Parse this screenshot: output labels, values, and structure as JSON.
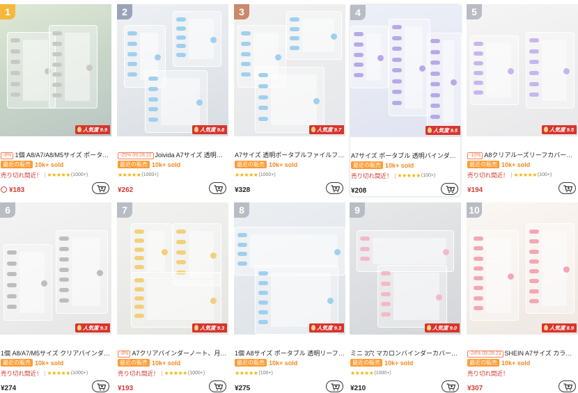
{
  "products": [
    {
      "rank": "1",
      "rank_style": "gold",
      "bg": "c1",
      "popularity": "人気度 9.9",
      "discount": "-8%",
      "title": "1個 A8/A7/A8/M5サイズ ポータ…",
      "sales_tag": "最近の販売",
      "sold": "10k+ sold",
      "stock": "売り切れ間近！",
      "stars": "★★★★★",
      "reviews": "(1000+)",
      "price": "¥183",
      "price_style": "red",
      "clock": true,
      "highlight": false,
      "ring": "#c8c8c8"
    },
    {
      "rank": "2",
      "rank_style": "silver",
      "bg": "c2",
      "popularity": "人気度 9.8",
      "discount": "-20% 09:28:22",
      "title": "Joivida A7サイズ 透明…",
      "sales_tag": "最近の販売",
      "sold": "10k+ sold",
      "stock": "",
      "stars": "★★★★★",
      "reviews": "(1000+)",
      "price": "¥262",
      "price_style": "red",
      "clock": false,
      "highlight": false,
      "ring": "#9fd0ee"
    },
    {
      "rank": "3",
      "rank_style": "bronze",
      "bg": "c3",
      "popularity": "人気度 9.7",
      "discount": "",
      "title": "A7サイズ 透明ポータブルファイルフ…",
      "sales_tag": "最近の販売",
      "sold": "10k+ sold",
      "stock": "",
      "stars": "★★★★★",
      "reviews": "(1000+)",
      "price": "¥328",
      "price_style": "black",
      "clock": false,
      "highlight": false,
      "ring": "#9fd0ee"
    },
    {
      "rank": "4",
      "rank_style": "grey",
      "bg": "c4",
      "popularity": "人気度 9.5",
      "discount": "",
      "title": "A7サイズ ポータブル 透明バインダー…",
      "sales_tag": "最近の販売",
      "sold": "10k+ sold",
      "stock": "売り切れ間近！",
      "stars": "★★★★★",
      "reviews": "(100+)",
      "price": "¥208",
      "price_style": "black",
      "clock": false,
      "highlight": true,
      "ring": "#b9a8e8"
    },
    {
      "rank": "5",
      "rank_style": "grey",
      "bg": "c5",
      "popularity": "人気度 9.5",
      "discount": "-10%",
      "title": "A8クリアルーズリーフカバー、…",
      "sales_tag": "最近の販売",
      "sold": "10k+ sold",
      "stock": "売り切れ間近！",
      "stars": "★★★★★",
      "reviews": "(100+)",
      "price": "¥194",
      "price_style": "red",
      "clock": false,
      "highlight": false,
      "ring": "#c7b6ee"
    },
    {
      "rank": "6",
      "rank_style": "grey",
      "bg": "c6",
      "popularity": "人気度 9.3",
      "discount": "",
      "title": "1個 A8/A7/M5サイズ クリアバインダ…",
      "sales_tag": "最近の販売",
      "sold": "10k+ sold",
      "stock": "売り切れ間近！",
      "stars": "★★★★★",
      "reviews": "(1000+)",
      "price": "¥274",
      "price_style": "black",
      "clock": false,
      "highlight": false,
      "ring": "#bdbdbd"
    },
    {
      "rank": "7",
      "rank_style": "grey",
      "bg": "c7",
      "popularity": "人気度 9.3",
      "discount": "-8%",
      "title": "A7クリアバインダーノート、月…",
      "sales_tag": "最近の販売",
      "sold": "10k+ sold",
      "stock": "売り切れ間近！",
      "stars": "★★★★★",
      "reviews": "(1000+)",
      "price": "¥193",
      "price_style": "red",
      "clock": false,
      "highlight": false,
      "ring": "#f2d07a"
    },
    {
      "rank": "8",
      "rank_style": "grey",
      "bg": "c8",
      "popularity": "人気度 9.3",
      "discount": "",
      "title": "1個 A8サイズ ポータブル 透明リーフ…",
      "sales_tag": "最近の販売",
      "sold": "10k+ sold",
      "stock": "",
      "stars": "★★★★★",
      "reviews": "(100+)",
      "price": "¥275",
      "price_style": "black",
      "clock": false,
      "highlight": false,
      "ring": "#9fd0ee"
    },
    {
      "rank": "9",
      "rank_style": "grey",
      "bg": "c9",
      "popularity": "人気度 9.0",
      "discount": "",
      "title": "ミニ 3穴 マカロンバインダーカバー…",
      "sales_tag": "最近の販売",
      "sold": "10k+ sold",
      "stock": "",
      "stars": "★★★★★",
      "reviews": "(1000+)",
      "price": "¥210",
      "price_style": "black",
      "clock": false,
      "highlight": false,
      "ring": "#f4b9c9"
    },
    {
      "rank": "10",
      "rank_style": "grey",
      "bg": "c10",
      "popularity": "人気度 8.9",
      "discount": "-24% 09:28:23",
      "title": "SHEIN A7サイズ カラ…",
      "sales_tag": "最近の販売",
      "sold": "10k+ sold",
      "stock": "売り切れ間近！",
      "stars": "",
      "reviews": "",
      "price": "¥307",
      "price_style": "red",
      "clock": false,
      "highlight": false,
      "ring": "#f3a6b4"
    }
  ]
}
